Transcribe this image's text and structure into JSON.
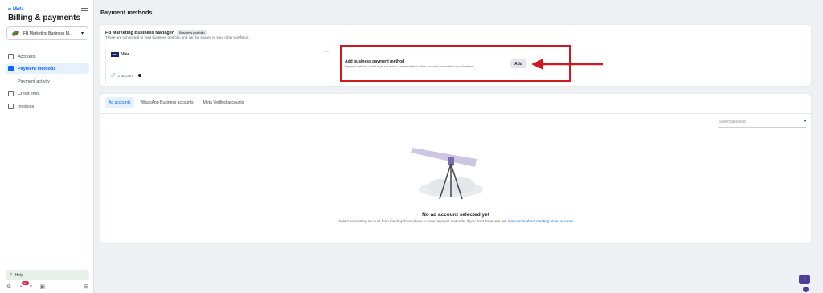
{
  "sidebar": {
    "brand": "∞ Meta",
    "app_title": "Billing & payments",
    "business_selector": "FB Marketing Business M...",
    "items": [
      {
        "label": "Accounts"
      },
      {
        "label": "Payment methods"
      },
      {
        "label": "Payment activity"
      },
      {
        "label": "Credit lines"
      },
      {
        "label": "Invoices"
      }
    ],
    "help_label": "Help",
    "notification_count": "9+"
  },
  "main": {
    "page_title": "Payment methods",
    "business_card": {
      "title": "FB Marketing Business Manager",
      "tag": "Business portfolio",
      "subtitle": "These are connected to your business portfolio and can be shared to your other portfolios.",
      "visa": {
        "logo": "VISA",
        "label": "Visa",
        "more": "···",
        "accounts": "1 account"
      },
      "add_panel": {
        "title": "Add business payment method",
        "description": "Payment methods added to your business can be shared to other accounts connected to your business.",
        "button": "Add"
      }
    },
    "tabs": [
      {
        "label": "Ad accounts"
      },
      {
        "label": "WhatsApp Business accounts"
      },
      {
        "label": "Meta Verified accounts"
      }
    ],
    "select_placeholder": "Select account",
    "empty_state": {
      "title": "No ad account selected yet",
      "description": "Select an existing account from the dropdown above to view payment methods. If you don't have one yet,",
      "link": "learn more about creating an ad account"
    }
  },
  "colors": {
    "accent": "#0866ff",
    "annotation": "#d0191f",
    "chat": "#4b3f9a"
  }
}
